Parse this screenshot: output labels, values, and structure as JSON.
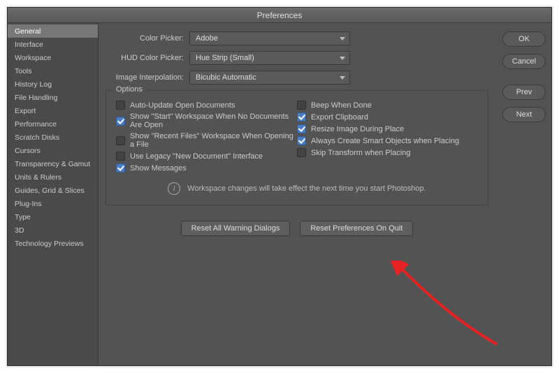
{
  "title": "Preferences",
  "sidebar": {
    "items": [
      "General",
      "Interface",
      "Workspace",
      "Tools",
      "History Log",
      "File Handling",
      "Export",
      "Performance",
      "Scratch Disks",
      "Cursors",
      "Transparency & Gamut",
      "Units & Rulers",
      "Guides, Grid & Slices",
      "Plug-Ins",
      "Type",
      "3D",
      "Technology Previews"
    ],
    "selected_index": 0
  },
  "buttons": {
    "ok": "OK",
    "cancel": "Cancel",
    "prev": "Prev",
    "next": "Next"
  },
  "fields": {
    "color_picker_label": "Color Picker:",
    "color_picker_value": "Adobe",
    "hud_label": "HUD Color Picker:",
    "hud_value": "Hue Strip (Small)",
    "interp_label": "Image Interpolation:",
    "interp_value": "Bicubic Automatic"
  },
  "options": {
    "legend": "Options",
    "left": [
      {
        "label": "Auto-Update Open Documents",
        "checked": false
      },
      {
        "label": "Show \"Start\" Workspace When No Documents Are Open",
        "checked": true
      },
      {
        "label": "Show \"Recent Files\" Workspace When Opening a File",
        "checked": false
      },
      {
        "label": "Use Legacy \"New Document\" Interface",
        "checked": false
      },
      {
        "label": "Show Messages",
        "checked": true
      }
    ],
    "right": [
      {
        "label": "Beep When Done",
        "checked": false
      },
      {
        "label": "Export Clipboard",
        "checked": true
      },
      {
        "label": "Resize Image During Place",
        "checked": true
      },
      {
        "label": "Always Create Smart Objects when Placing",
        "checked": true
      },
      {
        "label": "Skip Transform when Placing",
        "checked": false
      }
    ],
    "info": "Workspace changes will take effect the next time you start Photoshop."
  },
  "actions": {
    "reset_warnings": "Reset All Warning Dialogs",
    "reset_on_quit": "Reset Preferences On Quit"
  }
}
